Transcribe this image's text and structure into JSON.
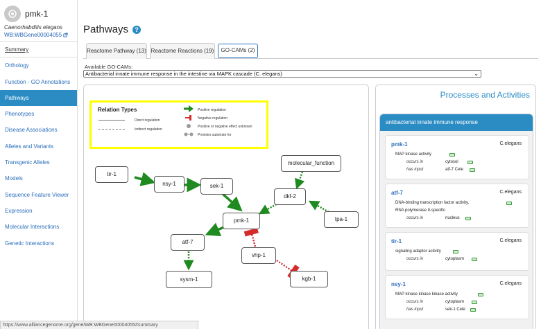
{
  "gene": {
    "symbol": "pmk-1",
    "species": "Caenorhabditis elegans",
    "id": "WB:WBGene00004055"
  },
  "sidebar": {
    "items": [
      {
        "label": "Summary"
      },
      {
        "label": "Orthology"
      },
      {
        "label": "Function - GO Annotations"
      },
      {
        "label": "Pathways"
      },
      {
        "label": "Phenotypes"
      },
      {
        "label": "Disease Associations"
      },
      {
        "label": "Alleles and Variants"
      },
      {
        "label": "Transgenic Alleles"
      },
      {
        "label": "Models"
      },
      {
        "label": "Sequence Feature Viewer"
      },
      {
        "label": "Expression"
      },
      {
        "label": "Molecular Interactions"
      },
      {
        "label": "Genetic Interactions"
      }
    ]
  },
  "main": {
    "title": "Pathways",
    "help_icon": "?",
    "tabs": [
      {
        "label": "Reactome Pathway (13)"
      },
      {
        "label": "Reactome Reactions (19)"
      },
      {
        "label": "GO-CAMs (2)"
      }
    ],
    "gocam_label": "Available GO-CAMs:",
    "gocam_selected": "Antibacterial innate immune response in the intestine via MAPK cascade (C. elegans)"
  },
  "legend": {
    "title": "Relation Types",
    "direct": "Direct regulation",
    "indirect": "Indirect regulation",
    "positive": "Positive regulation",
    "negative": "Negative regulation",
    "unknown": "Positive or negative effect unknown",
    "substrate": "Provides substrate for"
  },
  "graph": {
    "nodes": [
      {
        "label": "tir-1"
      },
      {
        "label": "nsy-1"
      },
      {
        "label": "sek-1"
      },
      {
        "label": "molecular_function"
      },
      {
        "label": "dkf-2"
      },
      {
        "label": "pmk-1"
      },
      {
        "label": "tpa-1"
      },
      {
        "label": "atf-7"
      },
      {
        "label": "vhp-1"
      },
      {
        "label": "sysm-1"
      },
      {
        "label": "kgb-1"
      }
    ]
  },
  "processes": {
    "title": "Processes and Activities",
    "process_name": "antibacterial innate immune response",
    "cards": [
      {
        "gene": "pmk-1",
        "species": "C.elegans",
        "activity": "MAP kinase activity",
        "occurs_label": "occurs in",
        "occurs_value": "cytosol",
        "input_label": "has input",
        "input_value": "atf-7 Cele"
      },
      {
        "gene": "atf-7",
        "species": "C.elegans",
        "activity": "DNA-binding transcription factor activity,",
        "activity2": "RNA polymerase II-specific",
        "occurs_label": "occurs in",
        "occurs_value": "nucleus"
      },
      {
        "gene": "tir-1",
        "species": "C.elegans",
        "activity": "signaling adaptor activity",
        "occurs_label": "occurs in",
        "occurs_value": "cytoplasm"
      },
      {
        "gene": "nsy-1",
        "species": "C.elegans",
        "activity": "MAP kinase kinase kinase activity",
        "occurs_label": "occurs in",
        "occurs_value": "cytoplasm",
        "input_label": "has input",
        "input_value": "sek-1 Cele"
      }
    ]
  },
  "statusbar": "https://www.alliancegenome.org/gene/WB:WBGene00004055#summary",
  "colors": {
    "accent": "#2b8cc4",
    "positive": "#1f8a1f",
    "negative": "#d42b2b",
    "legend_border": "#ffff00"
  }
}
